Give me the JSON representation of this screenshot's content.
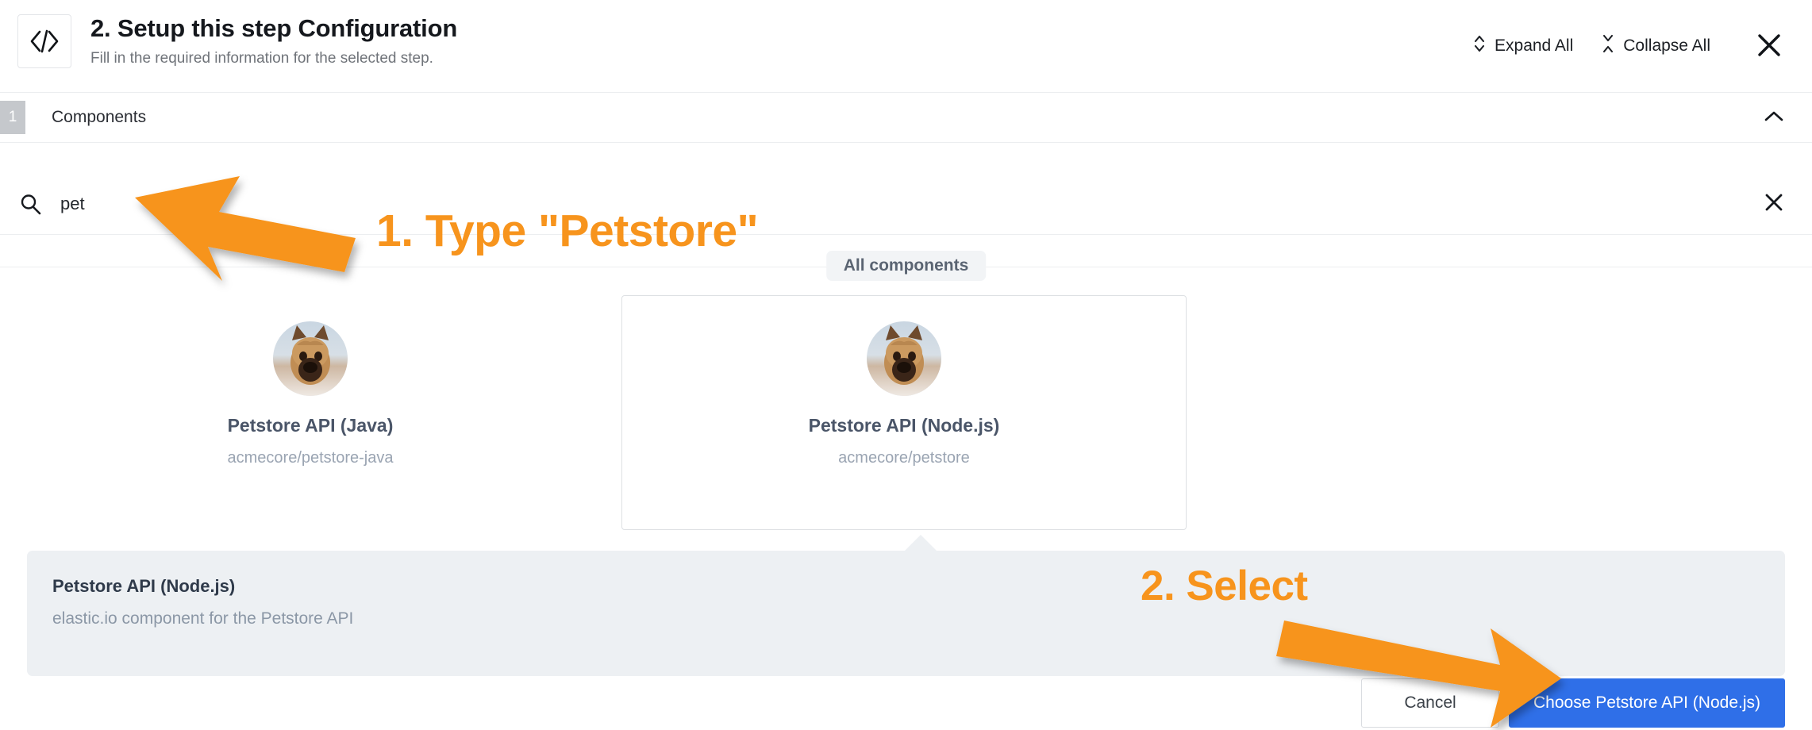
{
  "header": {
    "icon": "code-brackets-icon",
    "title": "2. Setup this step Configuration",
    "subtitle": "Fill in the required information for the selected step.",
    "expand_all_label": "Expand All",
    "collapse_all_label": "Collapse All",
    "expand_icon": "chevron-up-down-icon",
    "collapse_icon": "chevron-collapse-icon",
    "close_icon": "close-icon"
  },
  "section": {
    "step_number": "1",
    "title": "Components",
    "chevron_icon": "chevron-up-icon"
  },
  "search": {
    "value": "pet",
    "placeholder": "Search components",
    "icon": "search-icon",
    "clear_icon": "close-icon"
  },
  "components": {
    "group_label": "All components",
    "items": [
      {
        "name": "Petstore API (Java)",
        "repo": "acmecore/petstore-java",
        "avatar": "french-bulldog-avatar",
        "selected": false
      },
      {
        "name": "Petstore API (Node.js)",
        "repo": "acmecore/petstore",
        "avatar": "french-bulldog-avatar",
        "selected": true
      }
    ]
  },
  "detail": {
    "title": "Petstore API (Node.js)",
    "description": "elastic.io component for the Petstore API"
  },
  "footer": {
    "cancel_label": "Cancel",
    "choose_label": "Choose Petstore API (Node.js)"
  },
  "annotations": {
    "color": "#F7941D",
    "items": [
      {
        "id": "anno-1",
        "text": "1. Type \"Petstore\""
      },
      {
        "id": "anno-2",
        "text": "2. Select"
      }
    ]
  }
}
